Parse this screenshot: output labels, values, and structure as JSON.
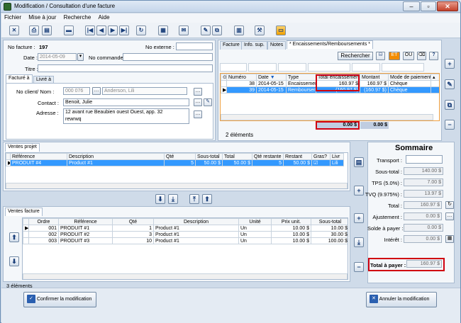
{
  "window": {
    "title": "Modification / Consultation d'une facture",
    "min": "‒",
    "max": "▫",
    "close": "✕"
  },
  "menu": [
    "Fichier",
    "Mise à jour",
    "Recherche",
    "Aide"
  ],
  "header": {
    "no_facture_label": "No facture :",
    "no_facture": "197",
    "no_externe_label": "No externe :",
    "no_externe": "",
    "date_label": "Date :",
    "date": "2014-05-09",
    "no_commande_label": "No commande :",
    "no_commande": "",
    "titre_label": "Titre :",
    "titre": ""
  },
  "client": {
    "tabs": [
      "Facturé à",
      "Livré à"
    ],
    "no_client_label": "No client/ Nom :",
    "no_client": "000 076",
    "nom": "Anderson, Lili",
    "contact_label": "Contact :",
    "contact": "Benoit, Julie",
    "adresse_label": "Adresse :",
    "adresse_1": "12 avant rue Beaubien ouest Ouest, app. 32",
    "adresse_2": "rewrwq"
  },
  "right_tabs": [
    "Facture",
    "Info. sup.",
    "Notes",
    "* Encaissements/Remboursements *"
  ],
  "search": {
    "rechercher": "Rechercher",
    "et": "ET",
    "ou": "OU",
    "help": "?"
  },
  "encaissements": {
    "columns": [
      "Numéro",
      "Date",
      "Type",
      "Total encaissement",
      "Montant",
      "Mode de paiement"
    ],
    "rows": [
      {
        "num": "38",
        "date": "2014-05-15",
        "type": "Encaissement",
        "total": "160.97 $",
        "montant": "160.97 $",
        "mode": "Chèque"
      },
      {
        "num": "39",
        "date": "2014-05-15",
        "type": "Remboursement",
        "total": "(160.97 $)",
        "montant": "(160.97 $)",
        "mode": "Chèque"
      }
    ],
    "sum_total": "0.00 $",
    "sum_montant": "0.00 $",
    "count": "2 éléments"
  },
  "ventes_projet": {
    "tab": "Ventes projet",
    "columns": [
      "Référence",
      "Description",
      "Qté",
      "Sous-total",
      "Total",
      "Qté restante",
      "Restant",
      "Gras?",
      "Livr"
    ],
    "rows": [
      {
        "ref": "PRODUIT #4",
        "desc": "Product #1",
        "qte": "5",
        "sous": "50.00 $",
        "total": "50.00 $",
        "rest": "5",
        "restant": "50.00 $",
        "liv": "Lili"
      }
    ]
  },
  "ventes_facture": {
    "tab": "Ventes facture",
    "columns": [
      "Ordre",
      "Référence",
      "Qté",
      "Description",
      "Unité",
      "Prix unit.",
      "Sous-total"
    ],
    "rows": [
      {
        "ordre": "001",
        "ref": "PRODUIT #1",
        "qte": "1",
        "desc": "Product #1",
        "unite": "Un",
        "prix": "10.00 $",
        "sous": "10.00 $"
      },
      {
        "ordre": "002",
        "ref": "PRODUIT #2",
        "qte": "3",
        "desc": "Product #1",
        "unite": "Un",
        "prix": "10.00 $",
        "sous": "30.00 $"
      },
      {
        "ordre": "003",
        "ref": "PRODUIT #3",
        "qte": "10",
        "desc": "Product #1",
        "unite": "Un",
        "prix": "10.00 $",
        "sous": "100.00 $"
      }
    ],
    "count": "3 éléments"
  },
  "sommaire": {
    "title": "Sommaire",
    "transport_label": "Transport :",
    "transport": "",
    "sous_total_label": "Sous-total :",
    "sous_total": "140.00 $",
    "tps_label": "TPS (5.0%) :",
    "tps": "7.00 $",
    "tvq_label": "TVQ (9.975%) :",
    "tvq": "13.97 $",
    "total_label": "Total :",
    "total": "160.97 $",
    "ajustement_label": "Ajustement :",
    "ajustement": "0.00 $",
    "solde_label": "Solde à payer :",
    "solde": "0.00 $",
    "interet_label": "Intérêt :",
    "interet": "0.00 $",
    "total_payer_label": "Total à payer :",
    "total_payer": "160.97 $"
  },
  "buttons": {
    "confirm": "Confirmer la modification",
    "cancel": "Annuler la modification"
  }
}
